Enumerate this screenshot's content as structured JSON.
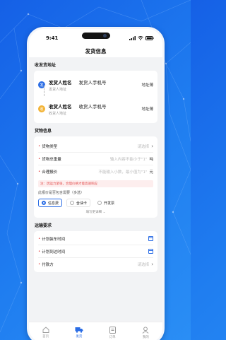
{
  "status": {
    "time": "9:41"
  },
  "header": {
    "title": "发货信息"
  },
  "address_section": {
    "title": "收发货地址",
    "sender": {
      "badge": "发",
      "name": "发货人姓名",
      "phone": "发货人手机号",
      "address": "发货人地址",
      "book": "地址薄"
    },
    "receiver": {
      "badge": "收",
      "name": "收货人姓名",
      "phone": "收货人手机号",
      "address": "收货人地址",
      "book": "地址薄"
    }
  },
  "goods_section": {
    "title": "货物信息",
    "type_label": "货物类型",
    "type_placeholder": "请选择",
    "weight_label": "货物总重量",
    "weight_placeholder": "输入内容不能小于\"1\"",
    "weight_unit": "吨",
    "price_label": "合理报价",
    "price_placeholder": "不能输入小数，最小值为\"1\"",
    "price_unit": "元",
    "note": "注：因运力紧张，合理价格才能高速响应",
    "ask": "此报价是否包含需要（多选）",
    "options": [
      "信息费",
      "含油卡",
      "开发票"
    ],
    "more": "填写更详细"
  },
  "transport_section": {
    "title": "运输要求",
    "load_time": "计划装车时间",
    "arrive_time": "计划到达时间",
    "payer_label": "付款方",
    "payer_placeholder": "请选择"
  },
  "tabs": [
    "首页",
    "发货",
    "订单",
    "我的"
  ],
  "colors": {
    "accent": "#2b6de5",
    "background": "#1f7df0"
  }
}
